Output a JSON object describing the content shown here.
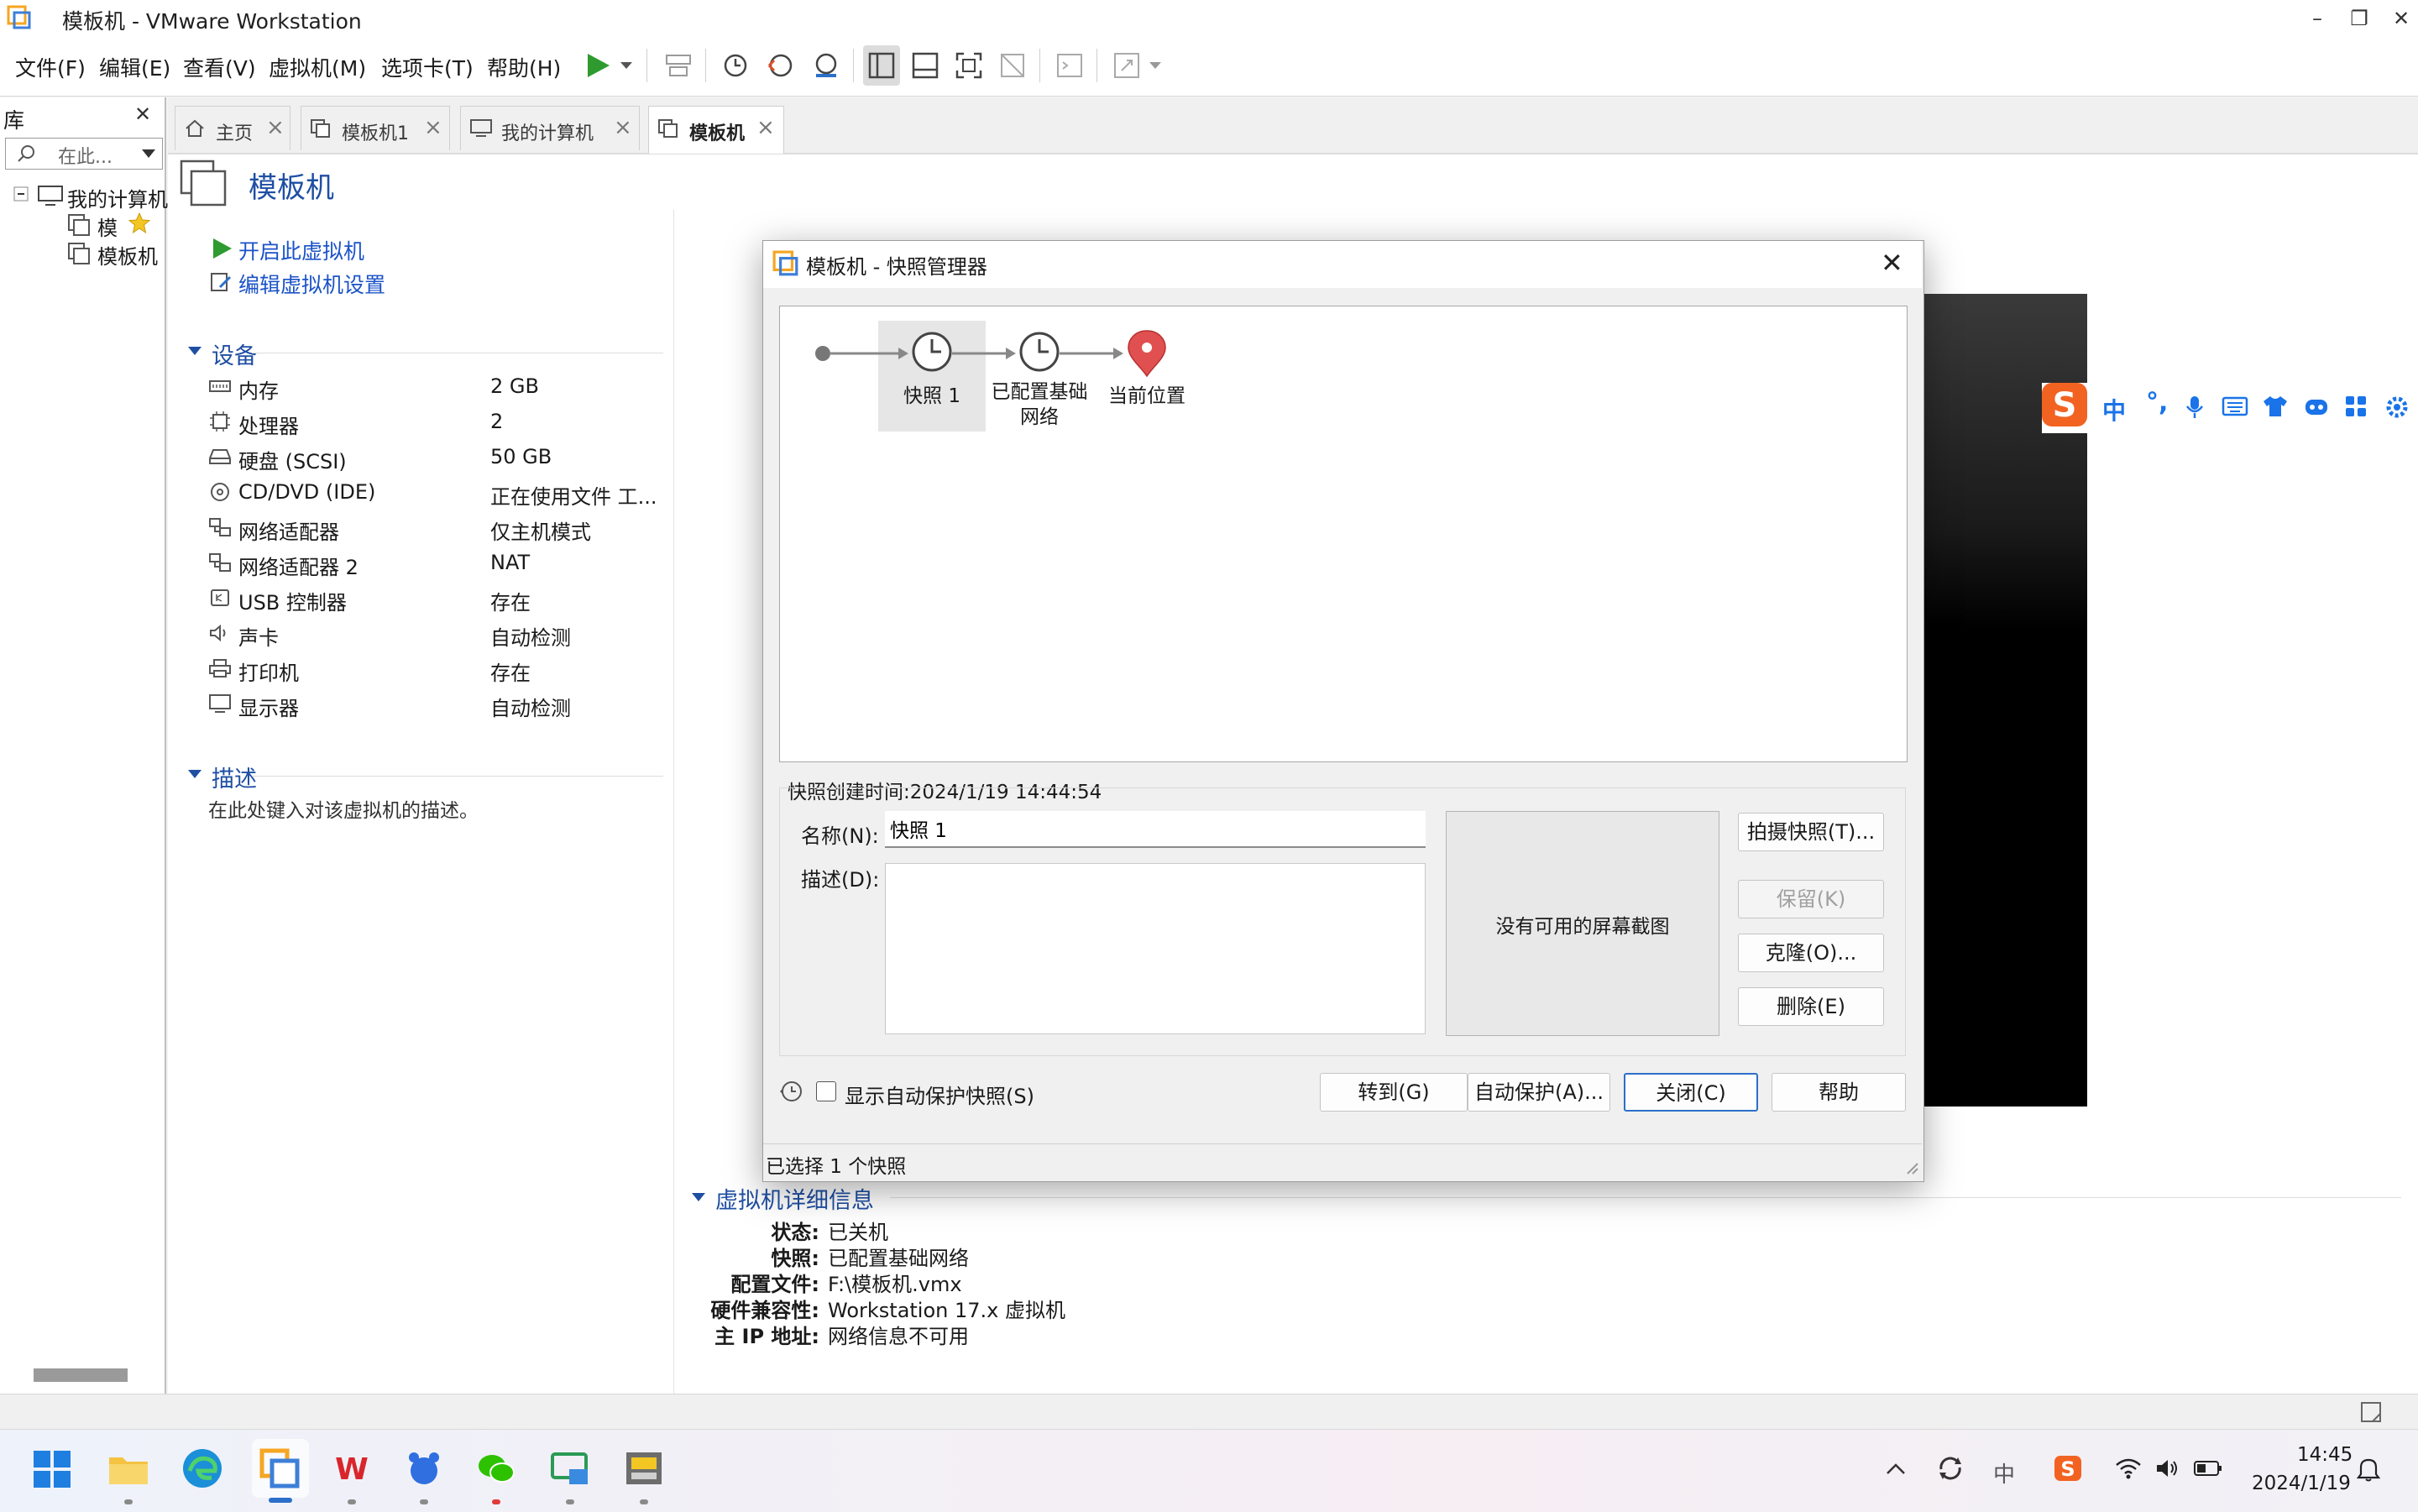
{
  "window": {
    "title": "模板机 - VMware Workstation"
  },
  "menu": {
    "file": "文件(F)",
    "edit": "编辑(E)",
    "view": "查看(V)",
    "vm": "虚拟机(M)",
    "tabs": "选项卡(T)",
    "help": "帮助(H)"
  },
  "library": {
    "title": "库",
    "search_placeholder": "在此...",
    "root": "我的计算机",
    "items": [
      "模",
      "模板机"
    ]
  },
  "tabs": [
    {
      "label": "主页"
    },
    {
      "label": "模板机1"
    },
    {
      "label": "我的计算机"
    },
    {
      "label": "模板机"
    }
  ],
  "vm": {
    "title": "模板机",
    "power_on": "开启此虚拟机",
    "edit_settings": "编辑虚拟机设置"
  },
  "devices": {
    "section": "设备",
    "rows": [
      {
        "name": "内存",
        "value": "2 GB",
        "icon": "memory-icon"
      },
      {
        "name": "处理器",
        "value": "2",
        "icon": "cpu-icon"
      },
      {
        "name": "硬盘 (SCSI)",
        "value": "50 GB",
        "icon": "disk-icon"
      },
      {
        "name": "CD/DVD (IDE)",
        "value": "正在使用文件 工...",
        "icon": "cd-icon"
      },
      {
        "name": "网络适配器",
        "value": "仅主机模式",
        "icon": "network-icon"
      },
      {
        "name": "网络适配器 2",
        "value": "NAT",
        "icon": "network-icon"
      },
      {
        "name": "USB 控制器",
        "value": "存在",
        "icon": "usb-icon"
      },
      {
        "name": "声卡",
        "value": "自动检测",
        "icon": "speaker-icon"
      },
      {
        "name": "打印机",
        "value": "存在",
        "icon": "printer-icon"
      },
      {
        "name": "显示器",
        "value": "自动检测",
        "icon": "monitor-icon"
      }
    ]
  },
  "description": {
    "section": "描述",
    "placeholder": "在此处键入对该虚拟机的描述。"
  },
  "details": {
    "section": "虚拟机详细信息",
    "rows": [
      {
        "label": "状态:",
        "value": "已关机"
      },
      {
        "label": "快照:",
        "value": "已配置基础网络"
      },
      {
        "label": "配置文件:",
        "value": "F:\\模板机.vmx"
      },
      {
        "label": "硬件兼容性:",
        "value": "Workstation 17.x 虚拟机"
      },
      {
        "label": "主 IP 地址:",
        "value": "网络信息不可用"
      }
    ]
  },
  "dialog": {
    "title": "模板机 - 快照管理器",
    "snapshots": [
      {
        "label": "快照 1",
        "selected": true
      },
      {
        "label": "已配置基础\n网络",
        "selected": false
      }
    ],
    "current_label": "当前位置",
    "created_time": "快照创建时间:2024/1/19 14:44:54",
    "name_label": "名称(N):",
    "name_value": "快照 1",
    "desc_label": "描述(D):",
    "no_screenshot": "没有可用的屏幕截图",
    "btn_take": "拍摄快照(T)...",
    "btn_keep": "保留(K)",
    "btn_clone": "克隆(O)...",
    "btn_delete": "删除(E)",
    "show_autoprotect": "显示自动保护快照(S)",
    "btn_goto": "转到(G)",
    "btn_autoprotect": "自动保护(A)...",
    "btn_close": "关闭(C)",
    "btn_help": "帮助",
    "status": "已选择 1 个快照"
  },
  "ime": {
    "lang": "中"
  },
  "taskbar": {
    "time": "14:45",
    "date": "2024/1/19",
    "ime_indicator": "中"
  },
  "colors": {
    "link": "#1b53c8",
    "section": "#1f4fa3",
    "accent": "#2c6fc9",
    "pin": "#e05050"
  }
}
